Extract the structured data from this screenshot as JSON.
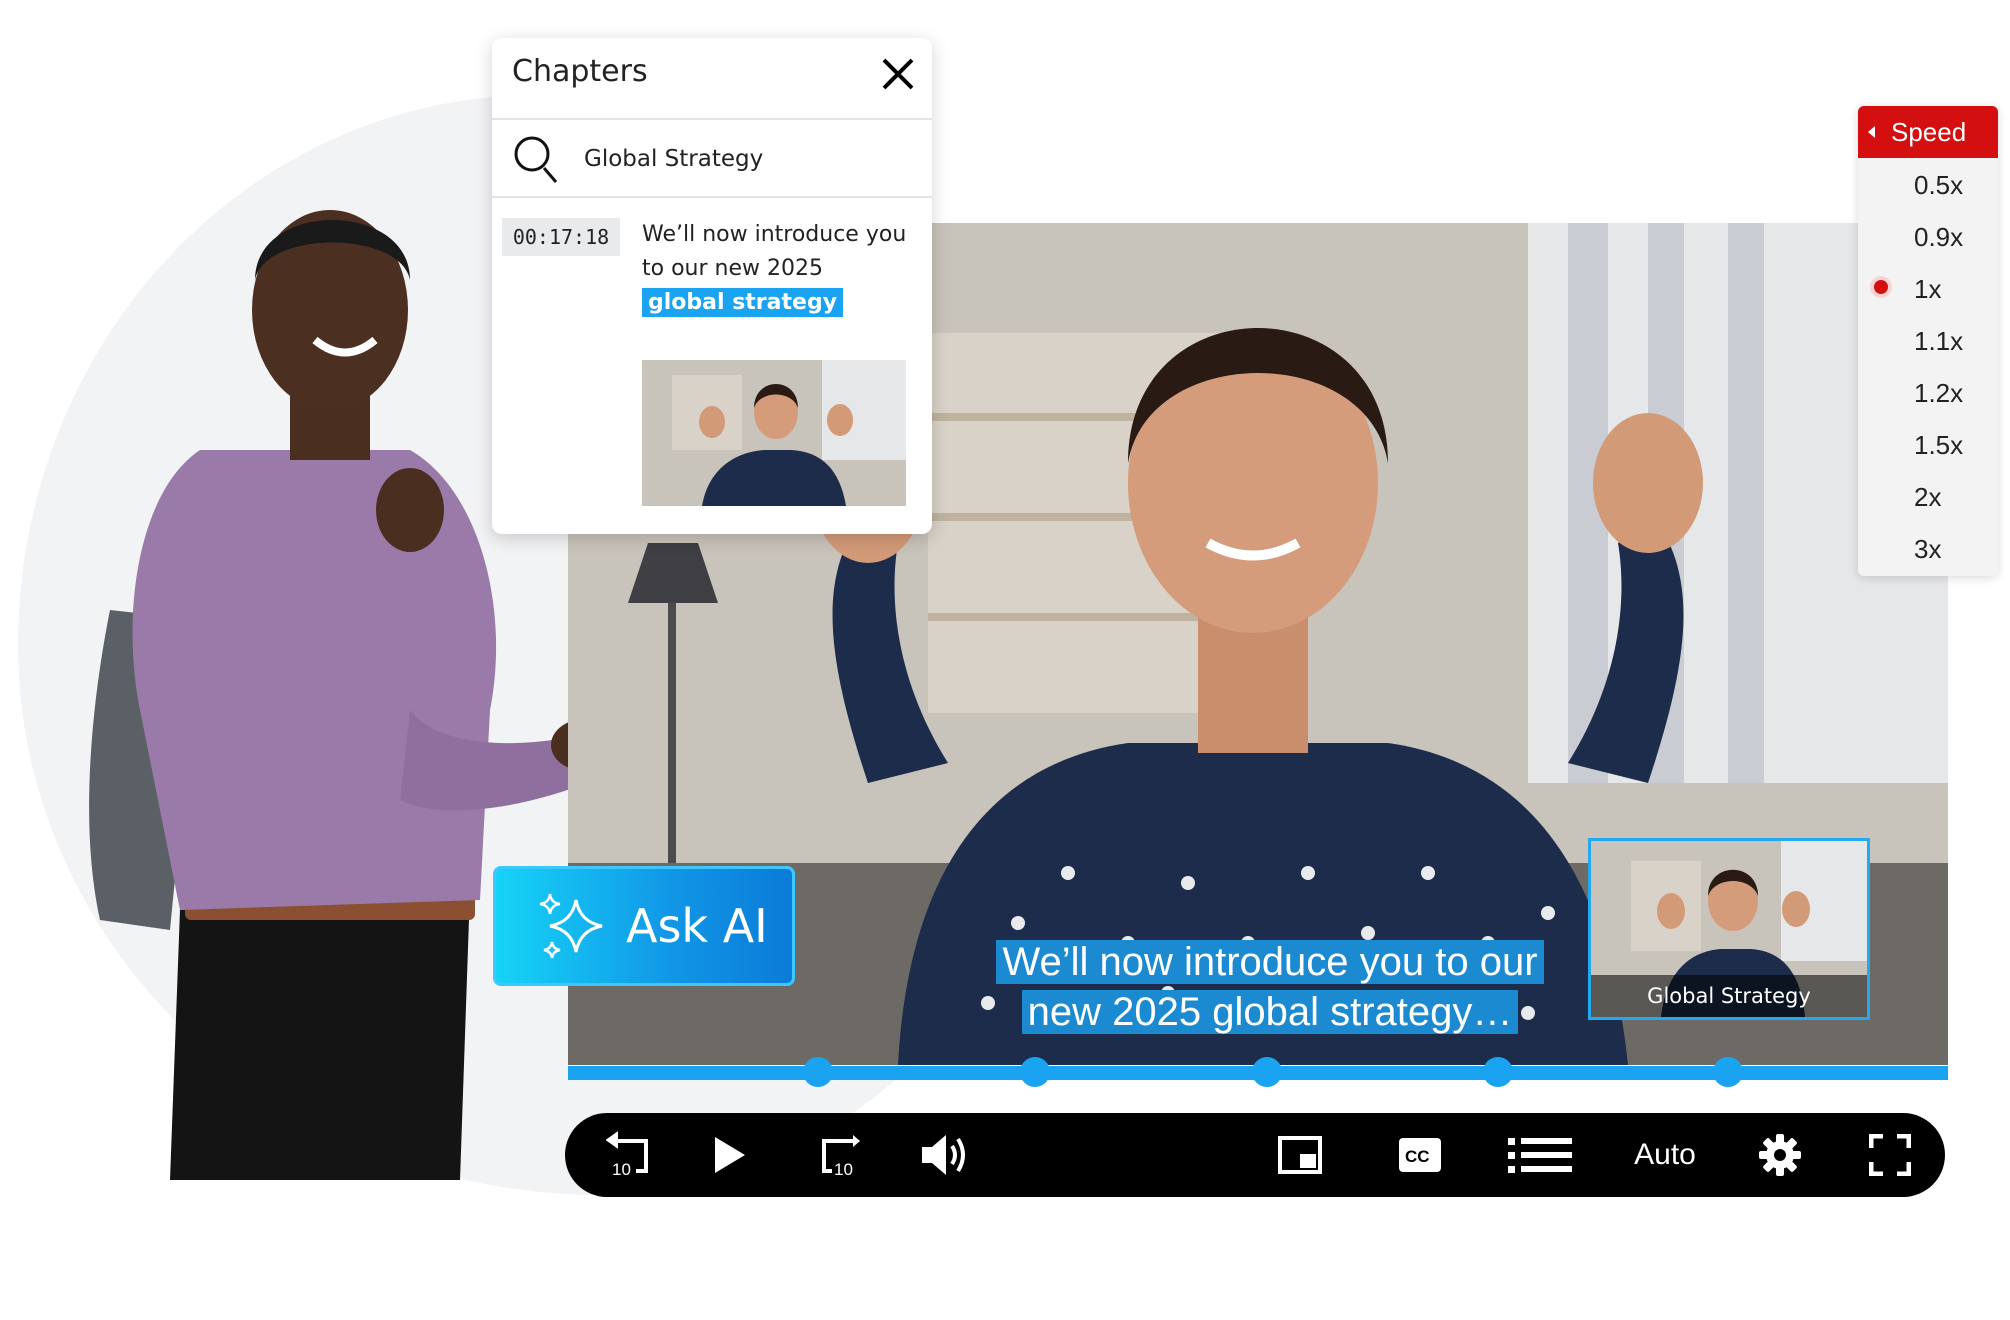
{
  "chapters": {
    "title": "Chapters",
    "search_value": "Global Strategy",
    "result": {
      "timestamp": "00:17:18",
      "text_before": "We’ll now introduce you to our new 2025",
      "highlight": "global strategy"
    }
  },
  "speed_menu": {
    "header": "Speed",
    "options": [
      "0.5x",
      "0.9x",
      "1x",
      "1.1x",
      "1.2x",
      "1.5x",
      "2x",
      "3x"
    ],
    "selected": "1x"
  },
  "video": {
    "subtitle_line1": "We’ll now introduce you to our",
    "subtitle_line2": "new 2025 global strategy…",
    "pip_label": "Global Strategy",
    "chapter_markers": 5
  },
  "ask_ai": {
    "label": "Ask AI"
  },
  "controls": {
    "rewind_seconds": "10",
    "forward_seconds": "10",
    "quality_label": "Auto",
    "icons": [
      "rewind-10-icon",
      "play-icon",
      "forward-10-icon",
      "volume-icon",
      "picture-in-picture-icon",
      "closed-captions-icon",
      "chapters-list-icon",
      "settings-gear-icon",
      "fullscreen-icon"
    ]
  },
  "colors": {
    "accent_blue": "#1aa3f0",
    "speed_header_red": "#d30f0f",
    "control_bar": "#000000"
  }
}
